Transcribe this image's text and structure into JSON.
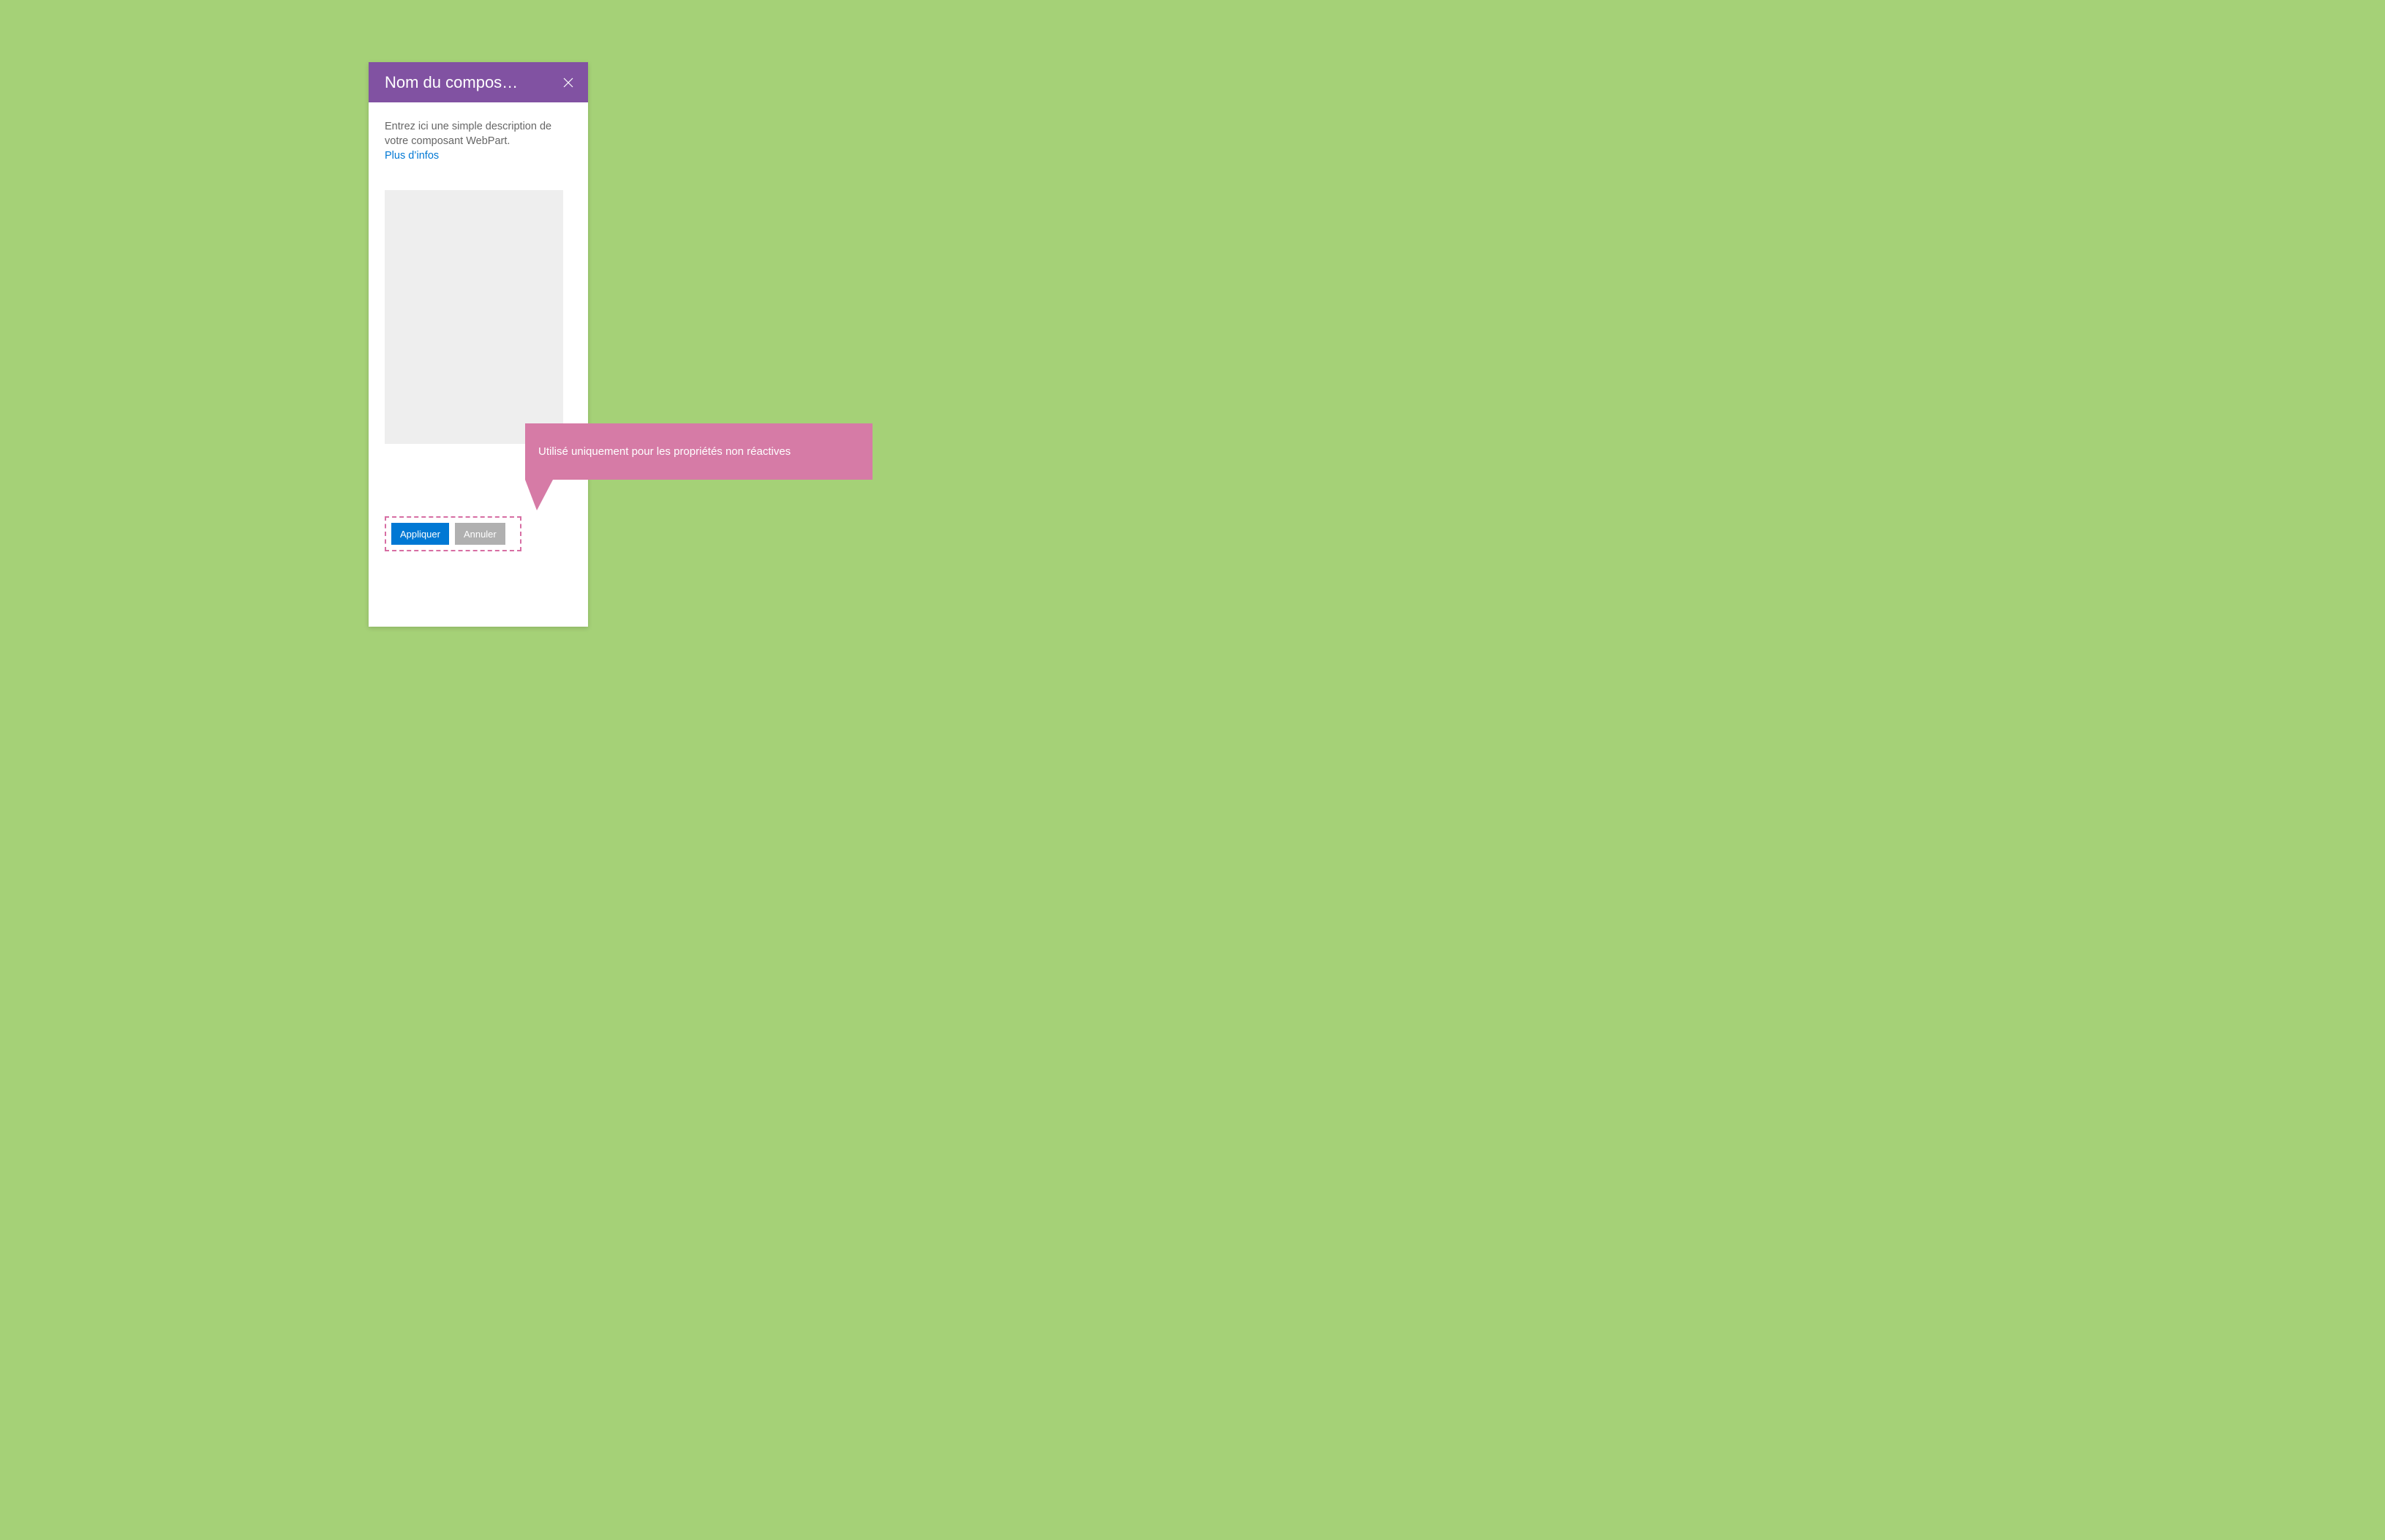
{
  "colors": {
    "background": "#a5d177",
    "header": "#8152a2",
    "primary": "#0078d4",
    "secondary": "#b0b0b0",
    "callout": "#d67ba6",
    "highlight_border": "#d76ea3"
  },
  "panel": {
    "title": "Nom du compos…",
    "description": "Entrez ici une simple description de votre composant WebPart.",
    "more_link": "Plus d’infos",
    "actions": {
      "apply": "Appliquer",
      "cancel": "Annuler"
    }
  },
  "callout": {
    "text": "Utilisé uniquement pour les propriétés non réactives"
  }
}
